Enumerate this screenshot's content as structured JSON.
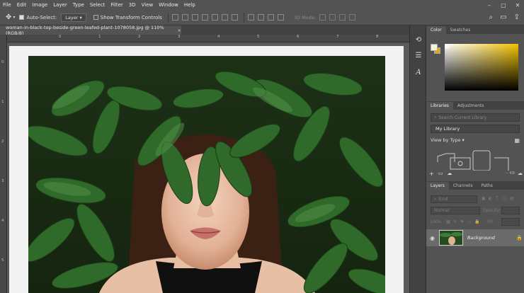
{
  "menu": [
    "File",
    "Edit",
    "Image",
    "Layer",
    "Type",
    "Select",
    "Filter",
    "3D",
    "View",
    "Window",
    "Help"
  ],
  "options": {
    "auto_select_label": "Auto-Select:",
    "auto_select_value": "Layer",
    "show_transform_label": "Show Transform Controls",
    "mode3d_label": "3D Mode:"
  },
  "document": {
    "tab_title": "woman-in-black-top-beside-green-leafed-plant-1078058.jpg @ 110% (RGB/8)",
    "close": "×",
    "ruler_numbers": [
      "0",
      "1",
      "2",
      "3",
      "4",
      "5",
      "6",
      "7",
      "8"
    ]
  },
  "panels": {
    "color_tabs": [
      "Color",
      "Swatches"
    ],
    "library_tabs": [
      "Libraries",
      "Adjustments"
    ],
    "library_search_placeholder": "Search Current Library",
    "library_name": "My Library",
    "view_by_type": "View by Type",
    "library_size": "-- KB",
    "layers_tabs": [
      "Layers",
      "Channels",
      "Paths"
    ],
    "layers_kind_label": "Kind",
    "blend_mode": "Normal",
    "opacity_label": "Opacity:",
    "fill_label": "Fill:",
    "lock_label": "Lock:",
    "background_layer": "Background"
  },
  "colors": {
    "ui_dark": "#424242",
    "ui_mid": "#535353",
    "fg_color": "#f6f0d8",
    "bg_color": "#e0a800"
  }
}
